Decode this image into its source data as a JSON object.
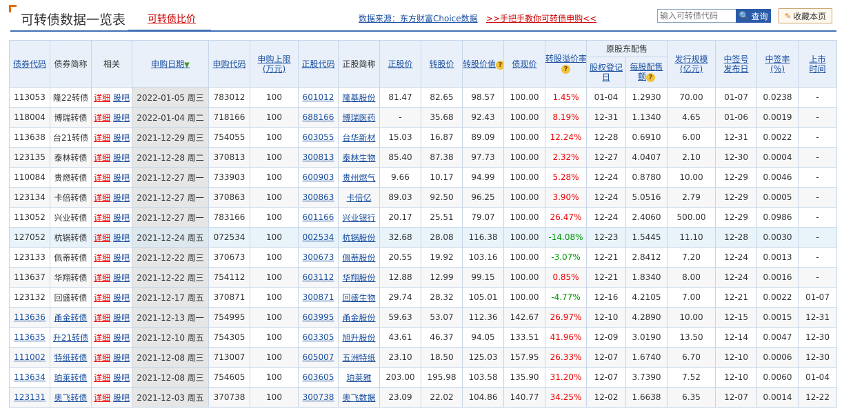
{
  "header": {
    "title": "可转债数据一览表",
    "compare_tab": "可转债比价",
    "source": "数据来源：东方财富Choice数据",
    "guide": ">>手把手教你可转债申购<<",
    "search_placeholder": "输入可转债代码",
    "search_label": "查询",
    "favorite_label": "收藏本页"
  },
  "columns": {
    "bond_code": "债券代码",
    "bond_name": "债券简称",
    "related": "相关",
    "sub_date": "申购日期",
    "sub_code": "申购代码",
    "sub_limit_1": "申购上限",
    "sub_limit_2": "(万元)",
    "stock_code": "正股代码",
    "stock_name": "正股简称",
    "stock_price": "正股价",
    "conv_price": "转股价",
    "conv_value": "转股价值",
    "bond_price": "债现价",
    "premium": "转股溢价率",
    "placement": "原股东配售",
    "record_date_1": "股权登记",
    "record_date_2": "日",
    "per_share_1": "每股配售",
    "per_share_2": "额",
    "issue_size_1": "发行规模",
    "issue_size_2": "(亿元)",
    "lot_date_1": "中签号",
    "lot_date_2": "发布日",
    "win_rate_1": "中签率",
    "win_rate_2": "(%)",
    "listing_1": "上市",
    "listing_2": "时间"
  },
  "labels": {
    "detail": "详细",
    "bar": "股吧",
    "q": "?",
    "sort_arrow": "▼"
  },
  "rows": [
    {
      "bond_code": "113053",
      "bond_name": "隆22转债",
      "sub_date": "2022-01-05 周三",
      "sub_code": "783012",
      "limit": "100",
      "stock_code": "601012",
      "stock_name": "隆基股份",
      "stock_price": "81.47",
      "conv_price": "82.65",
      "conv_value": "98.57",
      "bond_price": "100.00",
      "premium": "1.45%",
      "record": "01-04",
      "per_share": "1.2930",
      "size": "70.00",
      "lot": "01-07",
      "rate": "0.0238",
      "listing": "-"
    },
    {
      "bond_code": "118004",
      "bond_name": "博瑞转债",
      "sub_date": "2022-01-04 周二",
      "sub_code": "718166",
      "limit": "100",
      "stock_code": "688166",
      "stock_name": "博瑞医药",
      "stock_price": "-",
      "conv_price": "35.68",
      "conv_value": "92.43",
      "bond_price": "100.00",
      "premium": "8.19%",
      "record": "12-31",
      "per_share": "1.1340",
      "size": "4.65",
      "lot": "01-06",
      "rate": "0.0019",
      "listing": "-"
    },
    {
      "bond_code": "113638",
      "bond_name": "台21转债",
      "sub_date": "2021-12-29 周三",
      "sub_code": "754055",
      "limit": "100",
      "stock_code": "603055",
      "stock_name": "台华新材",
      "stock_price": "15.03",
      "conv_price": "16.87",
      "conv_value": "89.09",
      "bond_price": "100.00",
      "premium": "12.24%",
      "record": "12-28",
      "per_share": "0.6910",
      "size": "6.00",
      "lot": "12-31",
      "rate": "0.0022",
      "listing": "-"
    },
    {
      "bond_code": "123135",
      "bond_name": "泰林转债",
      "sub_date": "2021-12-28 周二",
      "sub_code": "370813",
      "limit": "100",
      "stock_code": "300813",
      "stock_name": "泰林生物",
      "stock_price": "85.40",
      "conv_price": "87.38",
      "conv_value": "97.73",
      "bond_price": "100.00",
      "premium": "2.32%",
      "record": "12-27",
      "per_share": "4.0407",
      "size": "2.10",
      "lot": "12-30",
      "rate": "0.0004",
      "listing": "-"
    },
    {
      "bond_code": "110084",
      "bond_name": "贵燃转债",
      "sub_date": "2021-12-27 周一",
      "sub_code": "733903",
      "limit": "100",
      "stock_code": "600903",
      "stock_name": "贵州燃气",
      "stock_price": "9.66",
      "conv_price": "10.17",
      "conv_value": "94.99",
      "bond_price": "100.00",
      "premium": "5.28%",
      "record": "12-24",
      "per_share": "0.8780",
      "size": "10.00",
      "lot": "12-29",
      "rate": "0.0046",
      "listing": "-"
    },
    {
      "bond_code": "123134",
      "bond_name": "卡倍转债",
      "sub_date": "2021-12-27 周一",
      "sub_code": "370863",
      "limit": "100",
      "stock_code": "300863",
      "stock_name": "卡倍亿",
      "stock_price": "89.03",
      "conv_price": "92.50",
      "conv_value": "96.25",
      "bond_price": "100.00",
      "premium": "3.90%",
      "record": "12-24",
      "per_share": "5.0516",
      "size": "2.79",
      "lot": "12-29",
      "rate": "0.0005",
      "listing": "-"
    },
    {
      "bond_code": "113052",
      "bond_name": "兴业转债",
      "sub_date": "2021-12-27 周一",
      "sub_code": "783166",
      "limit": "100",
      "stock_code": "601166",
      "stock_name": "兴业银行",
      "stock_price": "20.17",
      "conv_price": "25.51",
      "conv_value": "79.07",
      "bond_price": "100.00",
      "premium": "26.47%",
      "record": "12-24",
      "per_share": "2.4060",
      "size": "500.00",
      "lot": "12-29",
      "rate": "0.0986",
      "listing": "-"
    },
    {
      "bond_code": "127052",
      "bond_name": "杭锅转债",
      "sub_date": "2021-12-24 周五",
      "sub_code": "072534",
      "limit": "100",
      "stock_code": "002534",
      "stock_name": "杭锅股份",
      "stock_price": "32.68",
      "conv_price": "28.08",
      "conv_value": "116.38",
      "bond_price": "100.00",
      "premium": "-14.08%",
      "record": "12-23",
      "per_share": "1.5445",
      "size": "11.10",
      "lot": "12-28",
      "rate": "0.0030",
      "listing": "-"
    },
    {
      "bond_code": "123133",
      "bond_name": "佩蒂转债",
      "sub_date": "2021-12-22 周三",
      "sub_code": "370673",
      "limit": "100",
      "stock_code": "300673",
      "stock_name": "佩蒂股份",
      "stock_price": "20.55",
      "conv_price": "19.92",
      "conv_value": "103.16",
      "bond_price": "100.00",
      "premium": "-3.07%",
      "record": "12-21",
      "per_share": "2.8412",
      "size": "7.20",
      "lot": "12-24",
      "rate": "0.0013",
      "listing": "-"
    },
    {
      "bond_code": "113637",
      "bond_name": "华翔转债",
      "sub_date": "2021-12-22 周三",
      "sub_code": "754112",
      "limit": "100",
      "stock_code": "603112",
      "stock_name": "华翔股份",
      "stock_price": "12.88",
      "conv_price": "12.99",
      "conv_value": "99.15",
      "bond_price": "100.00",
      "premium": "0.85%",
      "record": "12-21",
      "per_share": "1.8340",
      "size": "8.00",
      "lot": "12-24",
      "rate": "0.0016",
      "listing": "-"
    },
    {
      "bond_code": "123132",
      "bond_name": "回盛转债",
      "sub_date": "2021-12-17 周五",
      "sub_code": "370871",
      "limit": "100",
      "stock_code": "300871",
      "stock_name": "回盛生物",
      "stock_price": "29.74",
      "conv_price": "28.32",
      "conv_value": "105.01",
      "bond_price": "100.00",
      "premium": "-4.77%",
      "record": "12-16",
      "per_share": "4.2105",
      "size": "7.00",
      "lot": "12-21",
      "rate": "0.0022",
      "listing": "01-07"
    },
    {
      "bond_code": "113636",
      "bond_name": "甬金转债",
      "sub_date": "2021-12-13 周一",
      "sub_code": "754995",
      "limit": "100",
      "stock_code": "603995",
      "stock_name": "甬金股份",
      "stock_price": "59.63",
      "conv_price": "53.07",
      "conv_value": "112.36",
      "bond_price": "142.67",
      "premium": "26.97%",
      "record": "12-10",
      "per_share": "4.2890",
      "size": "10.00",
      "lot": "12-15",
      "rate": "0.0015",
      "listing": "12-31"
    },
    {
      "bond_code": "113635",
      "bond_name": "升21转债",
      "sub_date": "2021-12-10 周五",
      "sub_code": "754305",
      "limit": "100",
      "stock_code": "603305",
      "stock_name": "旭升股份",
      "stock_price": "43.61",
      "conv_price": "46.37",
      "conv_value": "94.05",
      "bond_price": "133.51",
      "premium": "41.96%",
      "record": "12-09",
      "per_share": "3.0190",
      "size": "13.50",
      "lot": "12-14",
      "rate": "0.0047",
      "listing": "12-30"
    },
    {
      "bond_code": "111002",
      "bond_name": "特纸转债",
      "sub_date": "2021-12-08 周三",
      "sub_code": "713007",
      "limit": "100",
      "stock_code": "605007",
      "stock_name": "五洲特纸",
      "stock_price": "23.10",
      "conv_price": "18.50",
      "conv_value": "125.03",
      "bond_price": "157.95",
      "premium": "26.33%",
      "record": "12-07",
      "per_share": "1.6740",
      "size": "6.70",
      "lot": "12-10",
      "rate": "0.0006",
      "listing": "12-30"
    },
    {
      "bond_code": "113634",
      "bond_name": "珀莱转债",
      "sub_date": "2021-12-08 周三",
      "sub_code": "754605",
      "limit": "100",
      "stock_code": "603605",
      "stock_name": "珀莱雅",
      "stock_price": "203.00",
      "conv_price": "195.98",
      "conv_value": "103.58",
      "bond_price": "135.90",
      "premium": "31.20%",
      "record": "12-07",
      "per_share": "3.7390",
      "size": "7.52",
      "lot": "12-10",
      "rate": "0.0060",
      "listing": "01-04"
    },
    {
      "bond_code": "123131",
      "bond_name": "奥飞转债",
      "sub_date": "2021-12-03 周五",
      "sub_code": "370738",
      "limit": "100",
      "stock_code": "300738",
      "stock_name": "奥飞数据",
      "stock_price": "23.09",
      "conv_price": "22.02",
      "conv_value": "104.86",
      "bond_price": "140.77",
      "premium": "34.25%",
      "record": "12-02",
      "per_share": "1.6638",
      "size": "6.35",
      "lot": "12-07",
      "rate": "0.0014",
      "listing": "12-22"
    }
  ],
  "row_meta": {
    "highlight_index": 7,
    "linked_from_index": 11
  },
  "colors": {
    "accent": "#3f6fb6",
    "link": "#1a4fa0",
    "positive": "#e00000",
    "negative": "#009900"
  }
}
